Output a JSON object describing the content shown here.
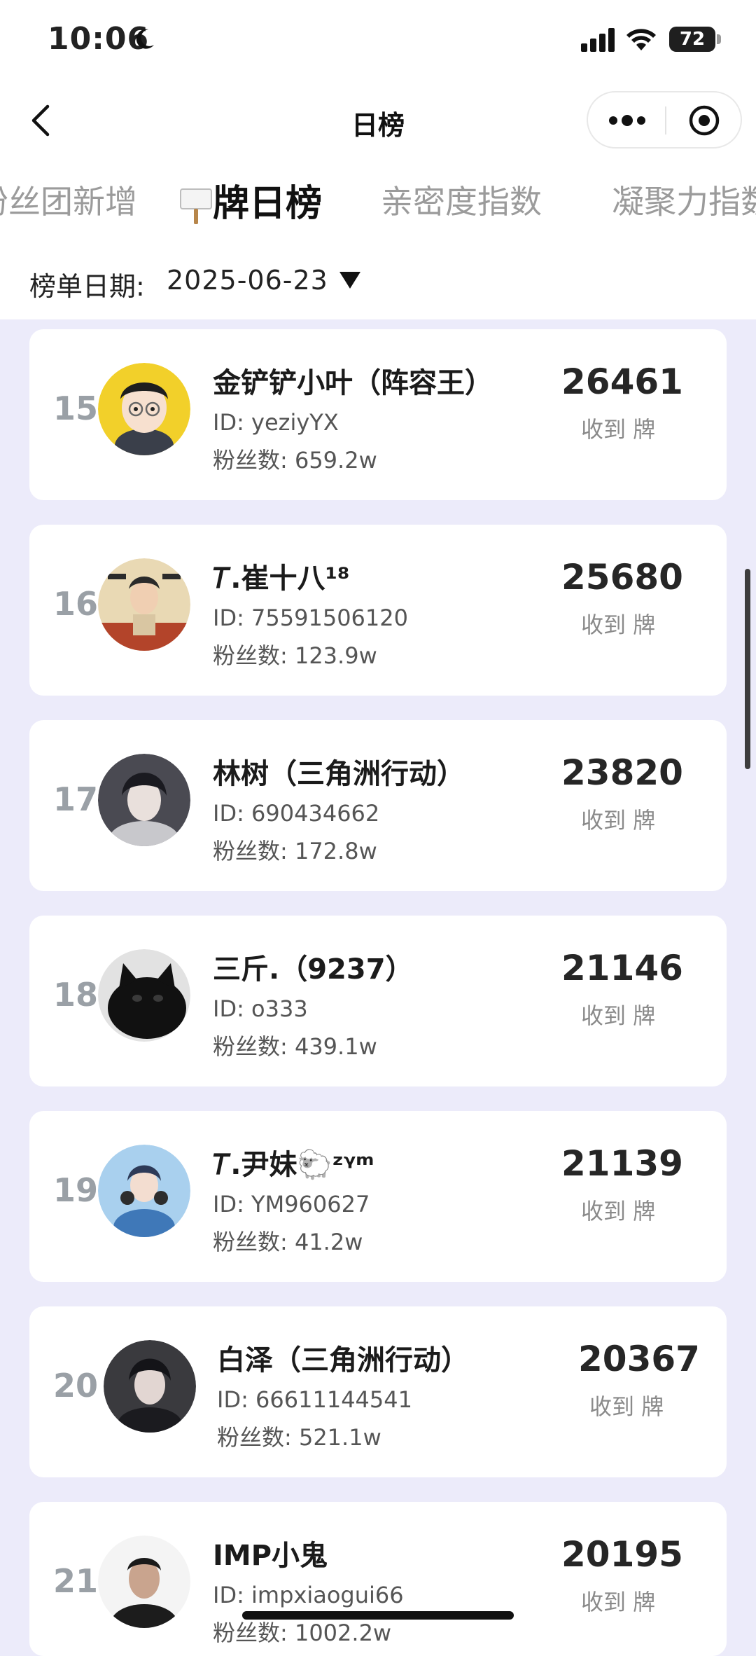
{
  "status_bar": {
    "time": "10:06",
    "battery": "72"
  },
  "nav": {
    "title": "日榜"
  },
  "tabs": [
    {
      "label": "粉丝团新增",
      "active": false
    },
    {
      "label": "牌日榜",
      "active": true
    },
    {
      "label": "亲密度指数",
      "active": false
    },
    {
      "label": "凝聚力指数",
      "active": false
    }
  ],
  "date_bar": {
    "label": "榜单日期:",
    "value": "2025-06-23"
  },
  "list": [
    {
      "rank": "15",
      "name": "金铲铲小叶（阵容王）",
      "id": "ID: yeziyYX",
      "fans": "粉丝数: 659.2w",
      "score": "26461",
      "received": "收到 牌"
    },
    {
      "rank": "16",
      "name": "𝑇.崔十八¹⁸",
      "id": "ID: 75591506120",
      "fans": "粉丝数: 123.9w",
      "score": "25680",
      "received": "收到 牌"
    },
    {
      "rank": "17",
      "name": "林树（三角洲行动）",
      "id": "ID: 690434662",
      "fans": "粉丝数: 172.8w",
      "score": "23820",
      "received": "收到 牌"
    },
    {
      "rank": "18",
      "name": "三斤.（9237）",
      "id": "ID: o333",
      "fans": "粉丝数: 439.1w",
      "score": "21146",
      "received": "收到 牌"
    },
    {
      "rank": "19",
      "name": "𝑇.尹妹🐑ᶻᵞᵐ",
      "id": "ID: YM960627",
      "fans": "粉丝数: 41.2w",
      "score": "21139",
      "received": "收到 牌"
    },
    {
      "rank": "20",
      "name": "白泽（三角洲行动）",
      "id": "ID: 66611144541",
      "fans": "粉丝数: 521.1w",
      "score": "20367",
      "received": "收到 牌"
    },
    {
      "rank": "21",
      "name": "IMP小鬼",
      "id": "ID: impxiaogui66",
      "fans": "粉丝数: 1002.2w",
      "score": "20195",
      "received": "收到 牌"
    }
  ],
  "colors": {
    "page_background": "#ecebfa",
    "card_background": "#ffffff",
    "rank_gray": "#9aa0a6"
  }
}
